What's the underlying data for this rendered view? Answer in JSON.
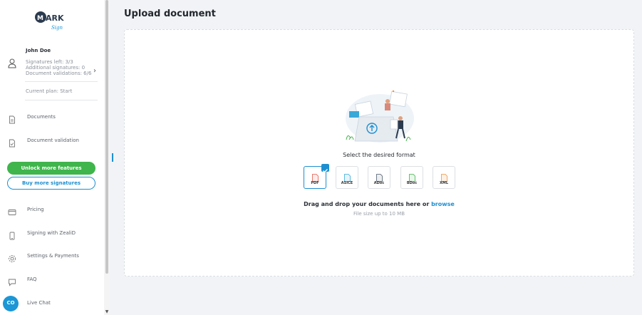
{
  "brand": {
    "logo_text": "MARK",
    "logo_script": "Sign"
  },
  "user": {
    "name": "John Doe",
    "signatures_left": "Signatures left: 3/3",
    "additional_signatures": "Additional signatures: 0",
    "document_validations": "Document validations: 6/6",
    "current_plan": "Current plan: Start"
  },
  "nav_top": [
    {
      "label": "Documents",
      "icon": "document-icon"
    },
    {
      "label": "Document validation",
      "icon": "document-check-icon"
    }
  ],
  "buttons": {
    "unlock": "Unlock more features",
    "buy": "Buy more signatures"
  },
  "nav_bottom": [
    {
      "label": "Pricing",
      "icon": "credit-card-icon"
    },
    {
      "label": "Signing with ZealiD",
      "icon": "phone-icon"
    },
    {
      "label": "Settings & Payments",
      "icon": "gear-icon"
    },
    {
      "label": "FAQ",
      "icon": "chat-bubble-icon"
    },
    {
      "label": "Live Chat",
      "icon": "live-chat-icon"
    }
  ],
  "chat_badge": "CO",
  "main": {
    "title": "Upload document",
    "select_format": "Select the desired format",
    "formats": [
      {
        "label": "PDF",
        "color": "#e05b4b",
        "selected": true
      },
      {
        "label": "ASICE",
        "color": "#39a9d8",
        "selected": false
      },
      {
        "label": "ADoc",
        "color": "#4d5a6a",
        "selected": false
      },
      {
        "label": "BDoc",
        "color": "#3fb54b",
        "selected": false
      },
      {
        "label": "XML",
        "color": "#f0923c",
        "selected": false
      }
    ],
    "drag_text": "Drag and drop your documents here or",
    "browse_label": "browse",
    "size_limit": "File size up to 10 MB"
  },
  "colors": {
    "accent": "#1d8fd0",
    "green": "#3fb54b",
    "text": "#2b2f36"
  }
}
